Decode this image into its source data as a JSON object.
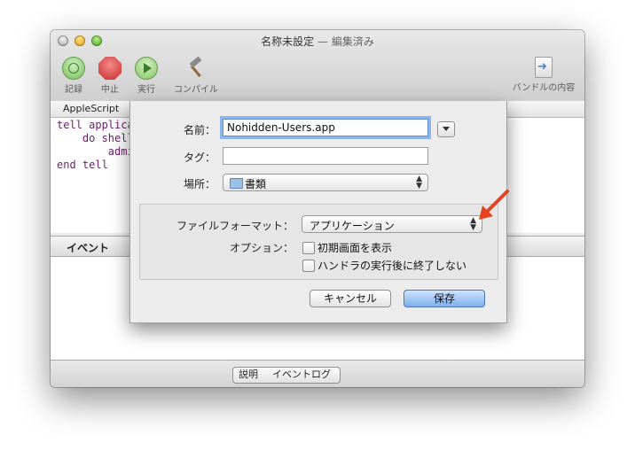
{
  "window": {
    "title": "名称未設定",
    "edited_suffix": " — 編集済み"
  },
  "toolbar": {
    "record": "記録",
    "stop": "中止",
    "run": "実行",
    "compile": "コンパイル",
    "bundle": "バンドルの内容"
  },
  "editor": {
    "language": "AppleScript",
    "code": [
      "tell applica",
      "    do shell",
      "        admi",
      "end tell"
    ]
  },
  "results": {
    "tab": "イベント"
  },
  "bottom": {
    "description": "説明",
    "event_log": "イベントログ"
  },
  "save_sheet": {
    "name_label": "名前：",
    "name_value": "Nohidden-Users.app",
    "tags_label": "タグ：",
    "tags_value": "",
    "where_label": "場所：",
    "where_value": "書類",
    "format_label": "ファイルフォーマット：",
    "format_value": "アプリケーション",
    "options_label": "オプション：",
    "option_startup": "初期画面を表示",
    "option_stay_open": "ハンドラの実行後に終了しない",
    "cancel": "キャンセル",
    "save": "保存"
  },
  "colors": {
    "accent": "#7fb0ee",
    "arrow": "#e5431d",
    "code": "#6b1e6b"
  }
}
